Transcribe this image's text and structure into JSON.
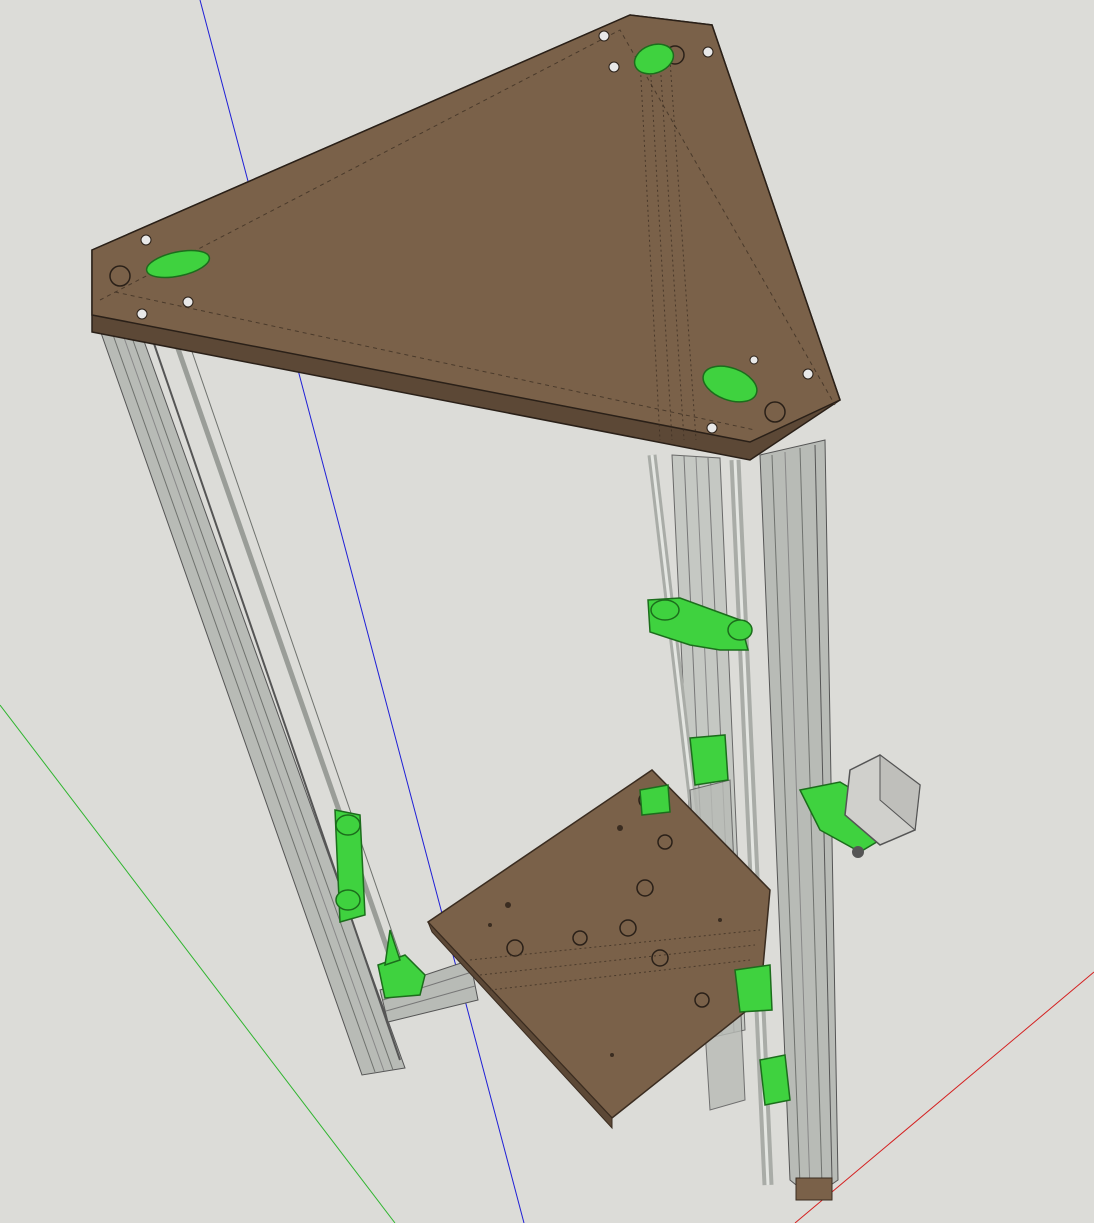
{
  "viewport": {
    "background": "#dcdcd8",
    "axis_colors": {
      "blue": "#1f1fd6",
      "green": "#2fb52f",
      "red": "#d42020"
    },
    "model": {
      "plate_color": "#7a6149",
      "plate_edge": "#3a2c20",
      "rail_color": "#b8bbb6",
      "printed_part_color": "#3fd23f",
      "motor_color": "#d0d0cc"
    },
    "parts": [
      "top-plate",
      "left-extrusion",
      "right-extrusions",
      "smooth-rods",
      "carriages",
      "print-bed",
      "bed-support-arm",
      "stepper-motor",
      "top-plate-green-clamps"
    ]
  }
}
